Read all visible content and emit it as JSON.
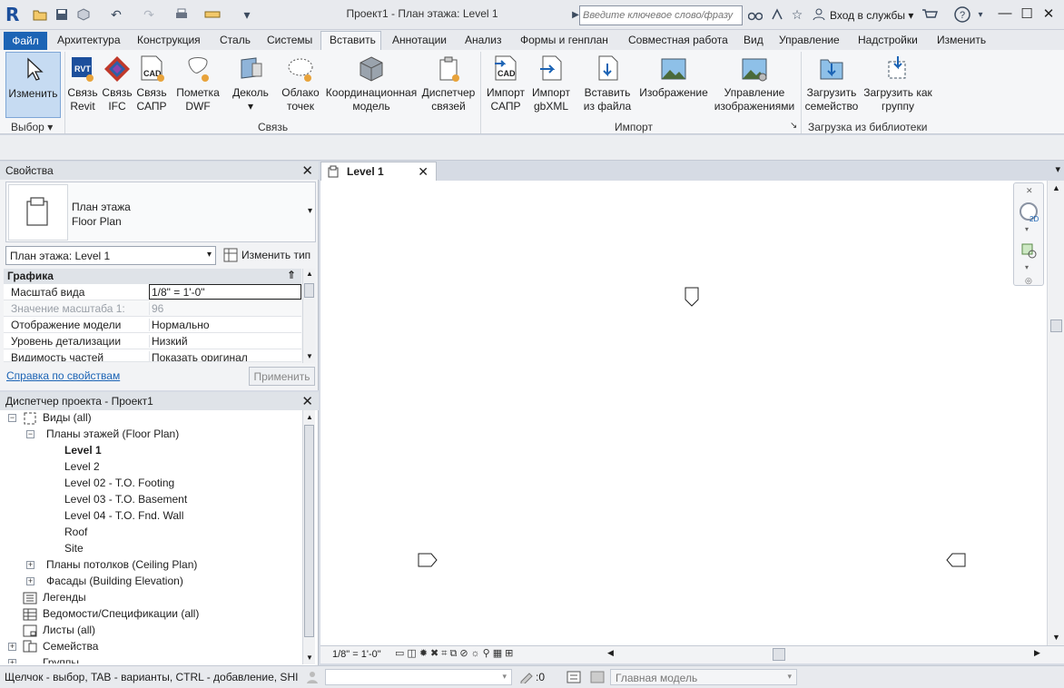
{
  "titlebar": {
    "title": "Проект1 - План этажа: Level 1",
    "search_placeholder": "Введите ключевое слово/фразу",
    "login": "Вход в службы"
  },
  "tabs": [
    {
      "label": "Файл"
    },
    {
      "label": "Архитектура"
    },
    {
      "label": "Конструкция"
    },
    {
      "label": "Сталь"
    },
    {
      "label": "Системы"
    },
    {
      "label": "Вставить"
    },
    {
      "label": "Аннотации"
    },
    {
      "label": "Анализ"
    },
    {
      "label": "Формы и генплан"
    },
    {
      "label": "Совместная работа"
    },
    {
      "label": "Вид"
    },
    {
      "label": "Управление"
    },
    {
      "label": "Надстройки"
    },
    {
      "label": "Изменить"
    }
  ],
  "ribbon": {
    "modify": {
      "label": "Изменить"
    },
    "select_panel": "Выбор",
    "link_panel": "Связь",
    "import_panel": "Импорт",
    "library_panel": "Загрузка из библиотеки",
    "buttons": {
      "link_revit": [
        "Связь",
        "Revit"
      ],
      "link_ifc": [
        "Связь",
        "IFC"
      ],
      "link_cad": [
        "Связь",
        "САПР"
      ],
      "dwf_markup": [
        "Пометка",
        "DWF"
      ],
      "decal": [
        "Деколь",
        ""
      ],
      "point_cloud": [
        "Облако",
        "точек"
      ],
      "coordination_model": [
        "Координационная",
        "модель"
      ],
      "manage_links": [
        "Диспетчер",
        "связей"
      ],
      "import_cad": [
        "Импорт",
        "САПР"
      ],
      "import_gbxml": [
        "Импорт",
        "gbXML"
      ],
      "insert_from_file": [
        "Вставить",
        "из файла"
      ],
      "image": [
        "Изображение",
        ""
      ],
      "manage_images": [
        "Управление",
        "изображениями"
      ],
      "load_family": [
        "Загрузить",
        "семейство"
      ],
      "load_as_group": [
        "Загрузить как",
        "группу"
      ]
    }
  },
  "properties": {
    "title": "Свойства",
    "type_name_1": "План этажа",
    "type_name_2": "Floor Plan",
    "view_selector": "План этажа: Level 1",
    "edit_type": "Изменить тип",
    "group": "Графика",
    "rows": [
      {
        "name": "Масштаб вида",
        "value": "1/8\" = 1'-0\""
      },
      {
        "name": "Значение масштаба    1:",
        "value": "96"
      },
      {
        "name": "Отображение модели",
        "value": "Нормально"
      },
      {
        "name": "Уровень детализации",
        "value": "Низкий"
      },
      {
        "name": "Видимость частей",
        "value": "Показать оригинал"
      }
    ],
    "help": "Справка по свойствам",
    "apply": "Применить"
  },
  "browser": {
    "title": "Диспетчер проекта - Проект1",
    "items": [
      {
        "label": "Виды (all)"
      },
      {
        "label": "Планы этажей (Floor Plan)"
      },
      {
        "label": "Level 1"
      },
      {
        "label": "Level 2"
      },
      {
        "label": "Level 02 - T.O. Footing"
      },
      {
        "label": "Level 03 - T.O. Basement"
      },
      {
        "label": "Level 04 - T.O. Fnd. Wall"
      },
      {
        "label": "Roof"
      },
      {
        "label": "Site"
      },
      {
        "label": "Планы потолков (Ceiling Plan)"
      },
      {
        "label": "Фасады (Building Elevation)"
      },
      {
        "label": "Легенды"
      },
      {
        "label": "Ведомости/Спецификации (all)"
      },
      {
        "label": "Листы (all)"
      },
      {
        "label": "Семейства"
      },
      {
        "label": "Группы"
      }
    ]
  },
  "view": {
    "tab_label": "Level 1",
    "scale": "1/8\" = 1'-0\""
  },
  "status": {
    "hint": "Щелчок - выбор, TAB - варианты, CTRL - добавление, SHIFT",
    "filter_count": ":0",
    "model": "Главная модель"
  }
}
